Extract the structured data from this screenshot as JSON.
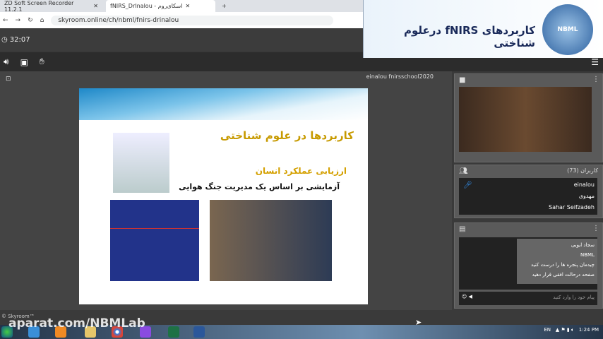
{
  "browser": {
    "tabs": [
      {
        "label": "ZD Soft Screen Recorder 11.2.1"
      },
      {
        "label": "fNIRS_DrInalou - اسکای‌روم"
      }
    ],
    "new_tab": "+",
    "url": "skyroom.online/ch/nbml/fnirs-drinalou"
  },
  "timer": "32:07",
  "banner": {
    "title": "کاربردهای fNIRS درعلوم شناختی",
    "logo_text": "NBML"
  },
  "presenter": {
    "header": "einalou fnirsschool2020"
  },
  "slide": {
    "title": "کاربردها در علوم شناختی",
    "bullet1": "ارزیابی عملکرد انسان",
    "bullet2": "آزمایشی بر اساس یک مدیریت جنگ هوایی"
  },
  "users": {
    "title": "کاربران (73)",
    "list": [
      "einalou",
      "مهدوی",
      "Sahar Seifzadeh"
    ]
  },
  "chat": {
    "sender": "سجاد ایوبی",
    "messages": [
      "NBML",
      "چیدمان پنجره ها را درست کنید",
      "صفحه درحالت افقی قرار دهید"
    ],
    "placeholder": "پیام خود را وارد کنید"
  },
  "footer": "© Skyroom™",
  "watermark": "aparat.com/NBMLab",
  "tray": {
    "lang": "EN",
    "time": "1:24 PM"
  }
}
